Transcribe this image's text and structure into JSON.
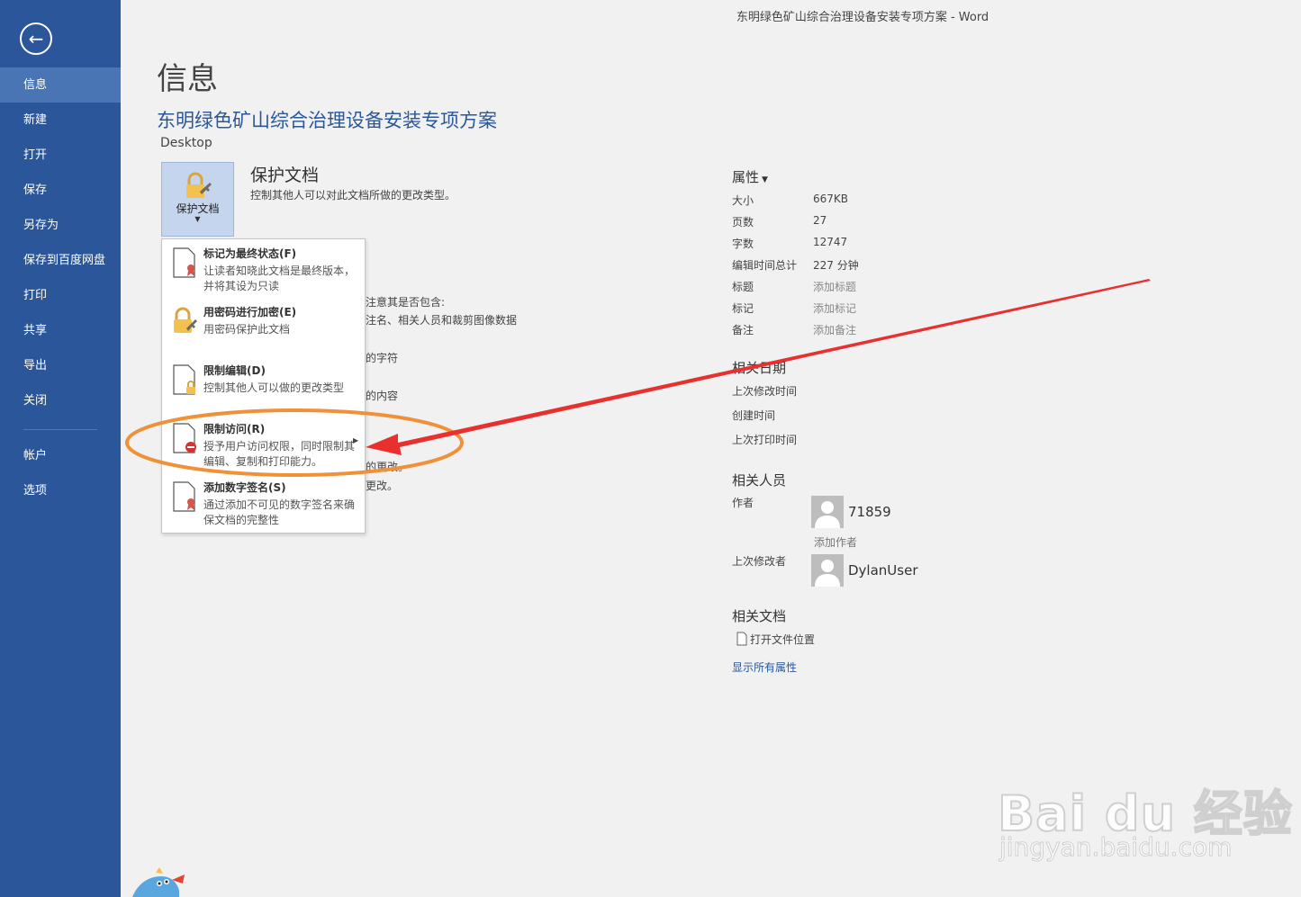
{
  "window": {
    "title": "东明绿色矿山综合治理设备安装专项方案 - Word"
  },
  "sidebar": {
    "items": [
      {
        "label": "信息",
        "active": true
      },
      {
        "label": "新建"
      },
      {
        "label": "打开"
      },
      {
        "label": "保存"
      },
      {
        "label": "另存为"
      },
      {
        "label": "保存到百度网盘"
      },
      {
        "label": "打印"
      },
      {
        "label": "共享"
      },
      {
        "label": "导出"
      },
      {
        "label": "关闭"
      }
    ],
    "bottom_items": [
      {
        "label": "帐户"
      },
      {
        "label": "选项"
      }
    ],
    "colors": {
      "background": "#2b579a",
      "active": "#4a75b5"
    }
  },
  "main": {
    "page_title": "信息",
    "document_title": "东明绿色矿山综合治理设备安装专项方案",
    "location": "Desktop",
    "protect": {
      "button_label": "保护文档",
      "heading": "保护文档",
      "description": "控制其他人可以对此文档所做的更改类型。"
    },
    "inspect_partial": {
      "line1": "注意其是否包含:",
      "line2": "注名、相关人员和裁剪图像数据",
      "line3": "的字符",
      "line4": "的内容",
      "line5": "的更改。",
      "line6": "更改。"
    },
    "protect_menu": [
      {
        "title": "标记为最终状态(F)",
        "desc": "让读者知晓此文档是最终版本，并将其设为只读",
        "icon": "final-doc-icon"
      },
      {
        "title": "用密码进行加密(E)",
        "desc": "用密码保护此文档",
        "icon": "lock-key-icon"
      },
      {
        "title": "限制编辑(D)",
        "desc": "控制其他人可以做的更改类型",
        "icon": "doc-lock-icon"
      },
      {
        "title": "限制访问(R)",
        "desc": "授予用户访问权限，同时限制其编辑、复制和打印能力。",
        "icon": "doc-restrict-icon"
      },
      {
        "title": "添加数字签名(S)",
        "desc": "通过添加不可见的数字签名来确保文档的完整性",
        "icon": "doc-signature-icon"
      }
    ]
  },
  "properties": {
    "header": "属性",
    "rows": [
      {
        "label": "大小",
        "value": "667KB"
      },
      {
        "label": "页数",
        "value": "27"
      },
      {
        "label": "字数",
        "value": "12747"
      },
      {
        "label": "编辑时间总计",
        "value": "227 分钟"
      },
      {
        "label": "标题",
        "value": "添加标题",
        "placeholder": true
      },
      {
        "label": "标记",
        "value": "添加标记",
        "placeholder": true
      },
      {
        "label": "备注",
        "value": "添加备注",
        "placeholder": true
      }
    ],
    "dates_header": "相关日期",
    "dates": [
      "上次修改时间",
      "创建时间",
      "上次打印时间"
    ],
    "people_header": "相关人员",
    "author_label": "作者",
    "author_name": "71859",
    "add_author": "添加作者",
    "modifier_label": "上次修改者",
    "modifier_name": "DylanUser",
    "docs_header": "相关文档",
    "open_location": "打开文件位置",
    "show_all": "显示所有属性"
  },
  "watermark": {
    "logo": "Bai du 经验",
    "url": "jingyan.baidu.com"
  },
  "annotation": {
    "ellipse_color": "#f0913a",
    "arrow_color": "#e8312f"
  }
}
